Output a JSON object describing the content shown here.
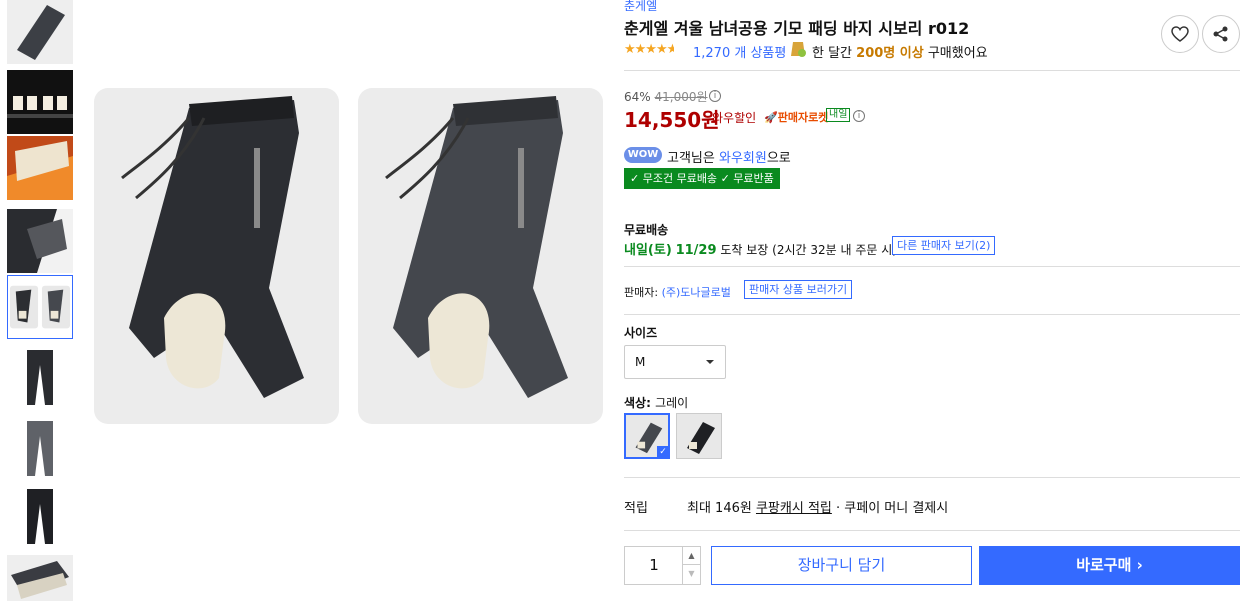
{
  "brand": "춘게엘",
  "title": "춘게엘 겨울 남녀공용 기모 패딩 바지 시보리 r012",
  "rating": {
    "stars": 4.5,
    "review_count": "1,270",
    "review_suffix": "개 상품평"
  },
  "purchase": {
    "prefix": "한 달간",
    "count": "200명 이상",
    "suffix": "구매했어요"
  },
  "price": {
    "discount_rate": "64%",
    "original": "41,000원",
    "sale": "14,550원",
    "wow_label": "와우할인",
    "rocket_label": "판매자로켓",
    "tomorrow_badge": "내일"
  },
  "wow": {
    "badge": "WOW",
    "text_a": "고객님은",
    "text_b": "와우회원",
    "text_c": "으로"
  },
  "benefits": [
    "무조건 무료배송",
    "무료반품"
  ],
  "shipping": {
    "label": "무료배송",
    "arrival_day": "내일(토)",
    "arrival_date": "11/29",
    "arrival_suffix": "도착 보장",
    "note": "(2시간 32분 내 주문 시)",
    "other_sellers": "다른 판매자 보기(2)"
  },
  "seller": {
    "label": "판매자:",
    "name": "(주)도나글로벌",
    "link": "판매자 상품 보러가기"
  },
  "size": {
    "label": "사이즈",
    "selected": "M"
  },
  "color": {
    "label": "색상:",
    "selected": "그레이",
    "options": [
      "grey",
      "black"
    ]
  },
  "points": {
    "label": "적립",
    "text_a": "최대 146원",
    "text_b": "쿠팡캐시 적립",
    "text_c": "· 쿠페이 머니 결제시"
  },
  "quantity": "1",
  "buttons": {
    "cart": "장바구니 담기",
    "buy": "바로구매"
  },
  "colors": {
    "accent": "#346aff",
    "price": "#ae0000",
    "green": "#0a8a1f"
  },
  "icons": [
    "heart-icon",
    "share-icon",
    "info-icon",
    "rocket-icon",
    "check-icon",
    "chevron-right-icon",
    "caret-down-icon"
  ]
}
